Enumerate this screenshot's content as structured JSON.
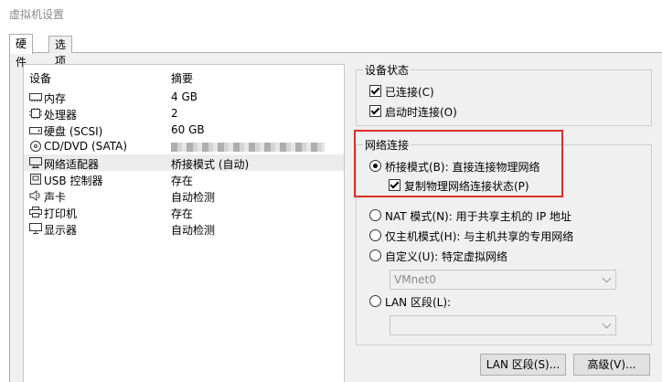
{
  "window": {
    "title": "虚拟机设置"
  },
  "tabs": [
    {
      "label": "硬件"
    },
    {
      "label": "选项"
    }
  ],
  "device_list": {
    "col_device": "设备",
    "col_summary": "摘要",
    "rows": [
      {
        "name": "内存",
        "summary": "4 GB",
        "icon": "memory-icon"
      },
      {
        "name": "处理器",
        "summary": "2",
        "icon": "cpu-icon"
      },
      {
        "name": "硬盘 (SCSI)",
        "summary": "60 GB",
        "icon": "hard-disk-icon"
      },
      {
        "name": "CD/DVD (SATA)",
        "summary": "",
        "icon": "cd-dvd-icon"
      },
      {
        "name": "网络适配器",
        "summary": "桥接模式 (自动)",
        "icon": "network-adapter-icon"
      },
      {
        "name": "USB 控制器",
        "summary": "存在",
        "icon": "usb-icon"
      },
      {
        "name": "声卡",
        "summary": "自动检测",
        "icon": "speaker-icon"
      },
      {
        "name": "打印机",
        "summary": "存在",
        "icon": "printer-icon"
      },
      {
        "name": "显示器",
        "summary": "自动检测",
        "icon": "monitor-icon"
      }
    ]
  },
  "device_status": {
    "title": "设备状态",
    "connected": {
      "label": "已连接(C)",
      "checked": true
    },
    "connect_on_power": {
      "label": "启动时连接(O)",
      "checked": true
    }
  },
  "network": {
    "title": "网络连接",
    "bridged": {
      "label": "桥接模式(B): 直接连接物理网络",
      "selected": true
    },
    "replicate": {
      "label": "复制物理网络连接状态(P)",
      "checked": true
    },
    "nat": {
      "label": "NAT 模式(N): 用于共享主机的 IP 地址",
      "selected": false
    },
    "host_only": {
      "label": "仅主机模式(H): 与主机共享的专用网络",
      "selected": false
    },
    "custom": {
      "label": "自定义(U): 特定虚拟网络",
      "selected": false
    },
    "custom_select": "VMnet0",
    "lan_segment": {
      "label": "LAN 区段(L):",
      "selected": false
    },
    "lan_select": ""
  },
  "buttons": {
    "lan_segments": "LAN 区段(S)...",
    "advanced": "高级(V)..."
  },
  "colors": {
    "highlight": "#d93025",
    "panel": "#f0f0f0"
  }
}
